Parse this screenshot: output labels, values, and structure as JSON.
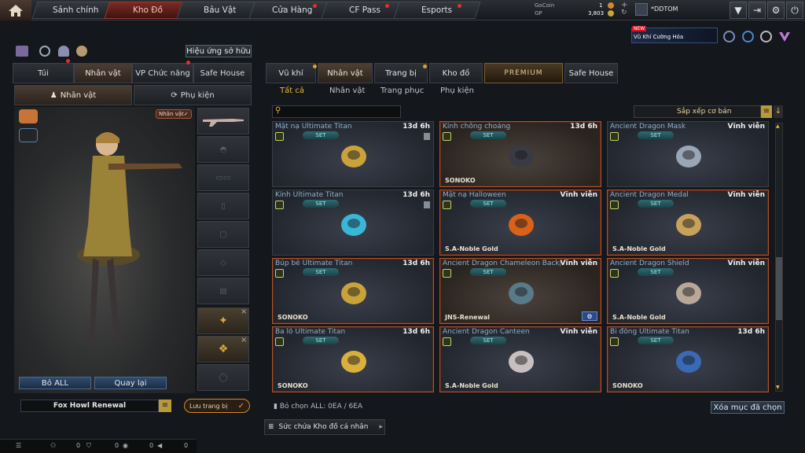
{
  "topnav": {
    "tabs": [
      "Sảnh chính",
      "Kho Đồ",
      "Bảu Vật",
      "Cửa Hàng",
      "CF Pass",
      "Esports"
    ],
    "active_index": 1,
    "currency": {
      "gocoin_label": "GoCoin",
      "gocoin_value": "1",
      "gp_label": "GP",
      "gp_value": "3,803"
    },
    "username": "*DDTOM",
    "promo_badge": "NEW",
    "promo_text": "Vũ Khí Cường Hóa"
  },
  "left": {
    "effect_button": "Hiệu ứng sở hữu",
    "tabs": [
      "Túi",
      "Nhân vật",
      "VP Chức năng",
      "Safe House"
    ],
    "subtabs": [
      "Nhân vật",
      "Phụ kiện"
    ],
    "char_badge": "Nhân vật✓",
    "btn_remove_all": "Bỏ ALL",
    "btn_back": "Quay lại",
    "character_name": "Fox Howl Renewal",
    "save_outfit": "Lưu trang bị"
  },
  "right": {
    "tabs": [
      "Vũ khí",
      "Nhân vật",
      "Trang bị",
      "Kho đồ",
      "PREMIUM",
      "Safe House"
    ],
    "subtabs": [
      "Tất cả",
      "Nhân vật",
      "Trang phục",
      "Phụ kiện"
    ],
    "sort_label": "Sắp xếp cơ bản",
    "selection_status": "Bỏ chọn ALL: 0EA / 6EA",
    "clear_selected": "Xóa mục đã chọn",
    "capacity_label": "Sức chứa Kho đồ cá nhân",
    "set_label": "SET",
    "items": [
      {
        "name": "Mặt nạ Ultimate Titan",
        "duration": "13d 6h",
        "owner": "",
        "style": "blue"
      },
      {
        "name": "Kính chống choáng",
        "duration": "13d 6h",
        "owner": "SONOKO",
        "style": "brown"
      },
      {
        "name": "Ancient Dragon Mask",
        "duration": "Vĩnh viễn",
        "owner": "",
        "style": "blue"
      },
      {
        "name": "Kính Ultimate Titan",
        "duration": "13d 6h",
        "owner": "",
        "style": "blue"
      },
      {
        "name": "Mặt nạ Halloween",
        "duration": "Vĩnh viễn",
        "owner": "S.A-Noble Gold",
        "style": "orange"
      },
      {
        "name": "Ancient Dragon Medal",
        "duration": "Vĩnh viễn",
        "owner": "S.A-Noble Gold",
        "style": "orange"
      },
      {
        "name": "Búp bê Ultimate Titan",
        "duration": "13d 6h",
        "owner": "SONOKO",
        "style": "orange"
      },
      {
        "name": "Ancient Dragon Chameleon Backpack",
        "duration": "Vĩnh viễn",
        "owner": "JNS-Renewal",
        "style": "brown"
      },
      {
        "name": "Ancient Dragon Shield",
        "duration": "Vĩnh viễn",
        "owner": "S.A-Noble Gold",
        "style": "orange"
      },
      {
        "name": "Ba lô Ultimate Titan",
        "duration": "13d 6h",
        "owner": "SONOKO",
        "style": "orange"
      },
      {
        "name": "Ancient Dragon Canteen",
        "duration": "Vĩnh viễn",
        "owner": "S.A-Noble Gold",
        "style": "orange"
      },
      {
        "name": "Bi đông Ultimate Titan",
        "duration": "13d 6h",
        "owner": "SONOKO",
        "style": "orange"
      }
    ]
  },
  "bottombar": {
    "count1": "0",
    "count2": "0",
    "count3": "0",
    "count4": "0"
  }
}
